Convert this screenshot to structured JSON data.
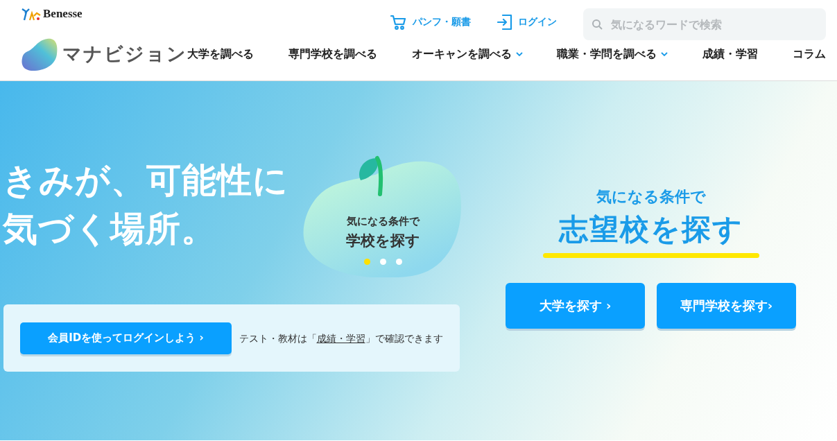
{
  "header": {
    "company_logo": "Benesse",
    "site_logo": "マナビジョン",
    "utility_links": [
      {
        "kind": "cart",
        "label": "パンフ・願書"
      },
      {
        "kind": "login",
        "label": "ログイン"
      }
    ],
    "search": {
      "placeholder": "気になるワードで検索"
    },
    "nav": [
      {
        "label": "大学を調べる",
        "has_menu": false
      },
      {
        "label": "専門学校を調べる",
        "has_menu": false
      },
      {
        "label": "オーキャンを調べる",
        "has_menu": true
      },
      {
        "label": "職業・学問を調べる",
        "has_menu": true
      },
      {
        "label": "成績・学習",
        "has_menu": false
      },
      {
        "label": "コラム",
        "has_menu": false
      }
    ]
  },
  "hero": {
    "headline": [
      "きみが、可能性に",
      "気づく場所。"
    ],
    "carousel": {
      "subtitle": "気になる条件で",
      "title": "学校を探す",
      "dots": [
        {
          "selected": true
        },
        {
          "selected": false
        },
        {
          "selected": false
        }
      ]
    },
    "login_card": {
      "button": "会員IDを使ってログインしよう ›",
      "note_before": "テスト・教材は「",
      "note_link": "成績・学習",
      "note_after": "」で確認できます"
    },
    "search_panel": {
      "subtitle": "気になる条件で",
      "title": "志望校を探す",
      "buttons": [
        "大学を探す ›",
        "専門学校を探す›"
      ]
    }
  }
}
